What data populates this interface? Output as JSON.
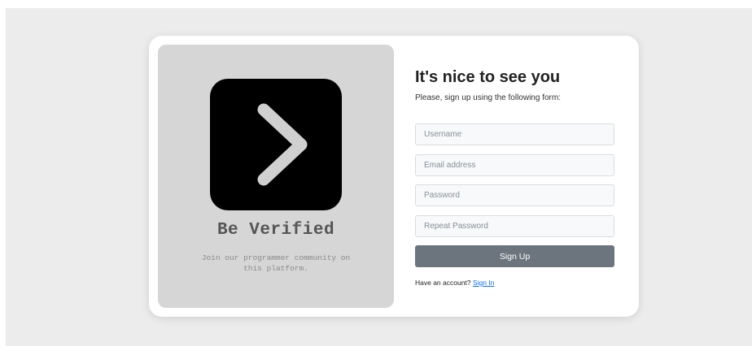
{
  "promo": {
    "logo_icon": "chevron-right-icon",
    "title": "Be Verified",
    "subtitle": "Join our programmer community on this platform."
  },
  "form": {
    "heading": "It's nice to see you",
    "subheading": "Please, sign up using the following form:",
    "username_placeholder": "Username",
    "email_placeholder": "Email address",
    "password_placeholder": "Password",
    "repeat_password_placeholder": "Repeat Password",
    "submit_label": "Sign Up",
    "account_prompt": "Have an account?",
    "signin_label": "Sign In"
  },
  "colors": {
    "page_background": "#ececec",
    "promo_background": "#d6d6d6",
    "button": "#6c757d",
    "link": "#0d6efd"
  }
}
